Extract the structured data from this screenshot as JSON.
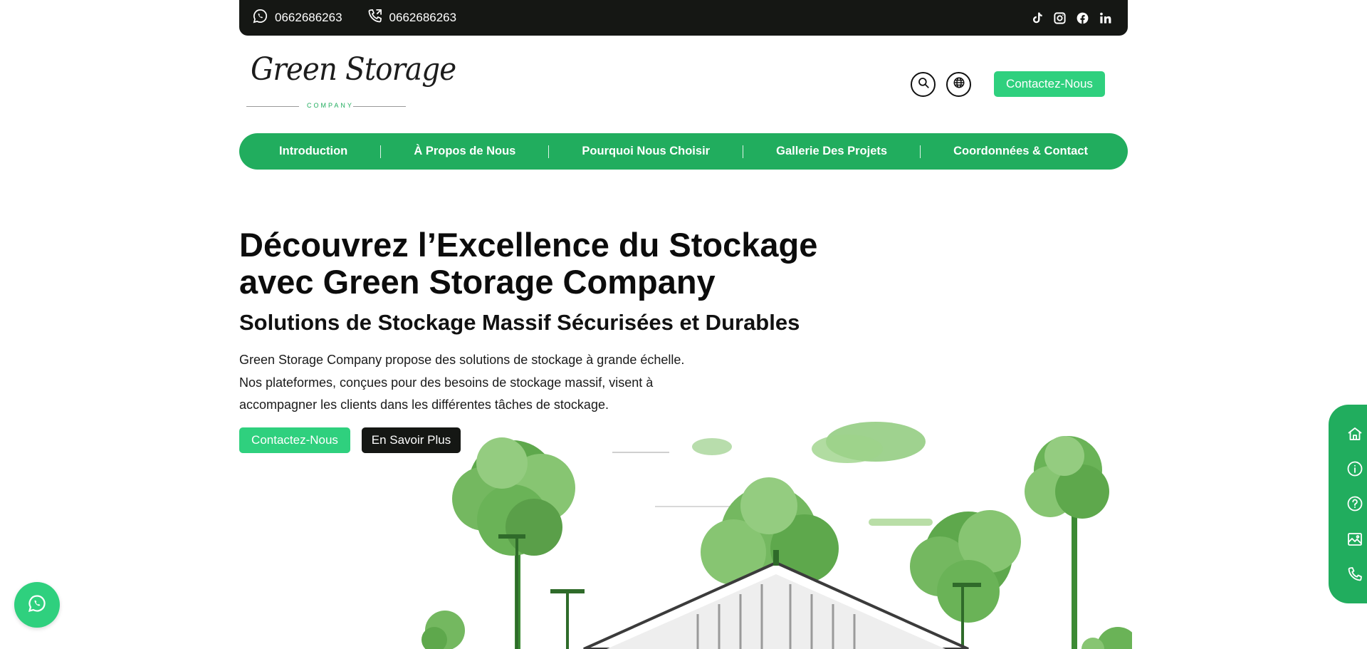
{
  "topbar": {
    "whatsapp": {
      "icon": "whatsapp-icon",
      "number": "0662686263"
    },
    "phone": {
      "icon": "phone-icon",
      "number": "0662686263"
    },
    "socials": [
      "tiktok-icon",
      "instagram-icon",
      "facebook-icon",
      "linkedin-icon"
    ]
  },
  "header": {
    "logo": {
      "script": "Green Storage",
      "tagline": "COMPANY"
    },
    "search_icon": "search-icon",
    "language_icon": "globe-icon",
    "contact_button": "Contactez-Nous"
  },
  "nav": {
    "items": [
      {
        "label": "Introduction"
      },
      {
        "label": "À Propos de Nous"
      },
      {
        "label": "Pourquoi Nous Choisir"
      },
      {
        "label": "Gallerie Des Projets"
      },
      {
        "label": "Coordonnées & Contact"
      }
    ]
  },
  "hero": {
    "title": "Découvrez l’Excellence du Stockage avec Green Storage Company",
    "subtitle": "Solutions de Stockage Massif Sécurisées et Durables",
    "description": "Green Storage Company propose des solutions de stockage à grande échelle. Nos plateformes, conçues pour des besoins de stockage massif, visent à accompagner les clients dans les différentes tâches de stockage.",
    "primary_button": "Contactez-Nous",
    "secondary_button": "En Savoir Plus",
    "illustration": "green-warehouse-trees-illustration"
  },
  "side_nav": [
    "home-icon",
    "info-icon",
    "question-icon",
    "gallery-icon",
    "phone-icon"
  ],
  "floating": {
    "whatsapp": "whatsapp-icon"
  },
  "colors": {
    "brand_green": "#21ad5e",
    "button_green": "#2fd07e",
    "dark": "#151714",
    "text": "#111111"
  }
}
